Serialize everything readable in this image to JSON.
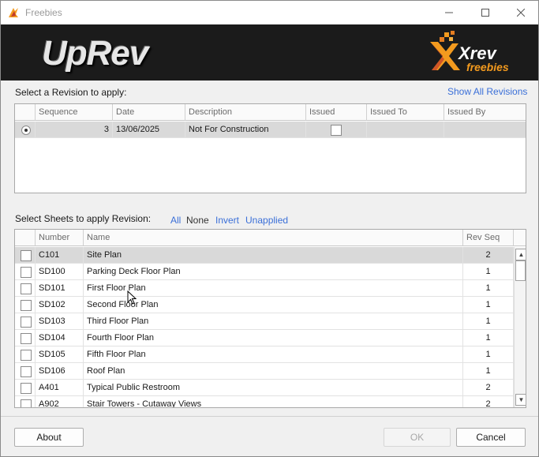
{
  "window": {
    "title": "Freebies"
  },
  "banner": {
    "logo_text": "UpRev",
    "brand_top": "Xrev",
    "brand_bottom": "freebies"
  },
  "revision_section": {
    "label": "Select a Revision to apply:",
    "show_all_link": "Show All Revisions",
    "columns": [
      "Sequence",
      "Date",
      "Description",
      "Issued",
      "Issued To",
      "Issued By"
    ],
    "rows": [
      {
        "sequence": "3",
        "date": "13/06/2025",
        "description": "Not For Construction",
        "issued": false,
        "issued_to": "",
        "issued_by": "",
        "selected": true
      }
    ]
  },
  "sheets_section": {
    "label": "Select Sheets to apply Revision:",
    "links": {
      "all": "All",
      "none": "None",
      "invert": "Invert",
      "unapplied": "Unapplied"
    },
    "columns": [
      "Number",
      "Name",
      "Rev Seq"
    ],
    "rows": [
      {
        "number": "C101",
        "name": "Site Plan",
        "rev_seq": "2",
        "selected": true
      },
      {
        "number": "SD100",
        "name": "Parking Deck Floor Plan",
        "rev_seq": "1"
      },
      {
        "number": "SD101",
        "name": "First Floor Plan",
        "rev_seq": "1"
      },
      {
        "number": "SD102",
        "name": "Second Floor Plan",
        "rev_seq": "1"
      },
      {
        "number": "SD103",
        "name": "Third Floor Plan",
        "rev_seq": "1"
      },
      {
        "number": "SD104",
        "name": "Fourth Floor Plan",
        "rev_seq": "1"
      },
      {
        "number": "SD105",
        "name": "Fifth Floor Plan",
        "rev_seq": "1"
      },
      {
        "number": "SD106",
        "name": "Roof Plan",
        "rev_seq": "1"
      },
      {
        "number": "A401",
        "name": "Typical Public Restroom",
        "rev_seq": "2"
      },
      {
        "number": "A902",
        "name": "Stair Towers - Cutaway Views",
        "rev_seq": "2"
      }
    ]
  },
  "buttons": {
    "about": "About",
    "ok": "OK",
    "cancel": "Cancel"
  },
  "colors": {
    "link": "#3a6fd8",
    "banner_bg": "#1b1b1b",
    "brand_orange": "#f39a1e",
    "selected_row": "#d9d9d9"
  }
}
